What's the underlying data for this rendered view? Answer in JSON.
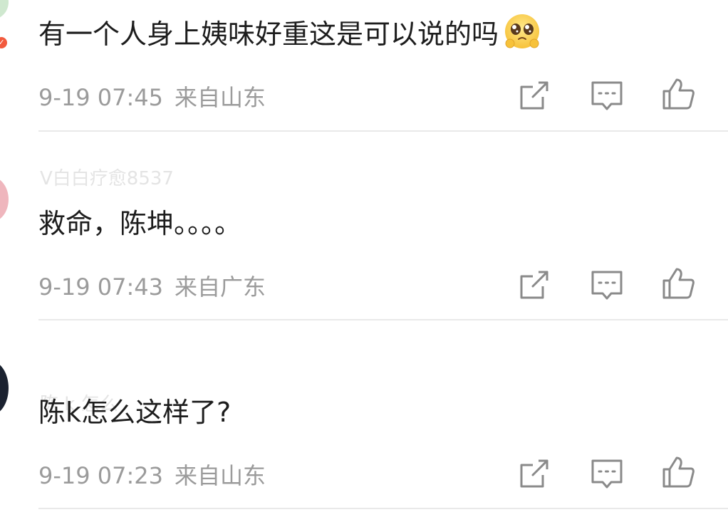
{
  "comments": [
    {
      "username": "",
      "text": "有一个人身上姨味好重这是可以说的吗",
      "emoji_icon": "pleading-face-emoji",
      "time": "9-19 07:45",
      "location": "来自山东",
      "avatar_color": "#cfe8cf"
    },
    {
      "username": "V白白疗愈8537",
      "text": "救命，陈坤。。。。",
      "time": "9-19 07:43",
      "location": "来自广东",
      "avatar_color": "#efb6bd"
    },
    {
      "username": "陈 k 怎么",
      "text": "陈k怎么这样了?",
      "time": "9-19 07:23",
      "location": "来自山东",
      "avatar_color": "#1b2230"
    }
  ],
  "actions": {
    "share_icon": "share-icon",
    "reply_icon": "comment-icon",
    "like_icon": "thumbs-up-icon"
  },
  "colors": {
    "text": "#1d1d1d",
    "meta": "#9b9b9b",
    "icon": "#8a8a8a",
    "divider": "#e9e9e9",
    "badge": "#f25a3d"
  }
}
